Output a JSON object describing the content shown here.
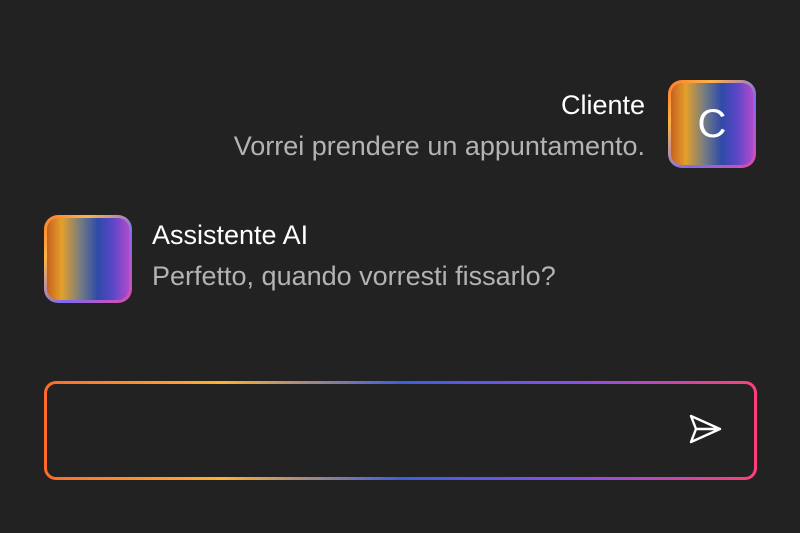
{
  "conversation": {
    "messages": [
      {
        "role": "user",
        "sender": "Cliente",
        "avatar_initial": "C",
        "text": "Vorrei prendere un appuntamento."
      },
      {
        "role": "assistant",
        "sender": "Assistente AI",
        "text": "Perfetto, quando vorresti fissarlo?"
      }
    ]
  },
  "composer": {
    "input_value": "",
    "send_icon": "send-icon"
  },
  "colors": {
    "background": "#222222",
    "name_text": "#ffffff",
    "message_text": "#b3b3b3",
    "gradient_orange": "#ff6a2a",
    "gradient_yellow": "#ffb02e",
    "gradient_blue": "#3c5fe0",
    "gradient_purple": "#8a4fe8",
    "gradient_pink": "#ff3f7a"
  }
}
